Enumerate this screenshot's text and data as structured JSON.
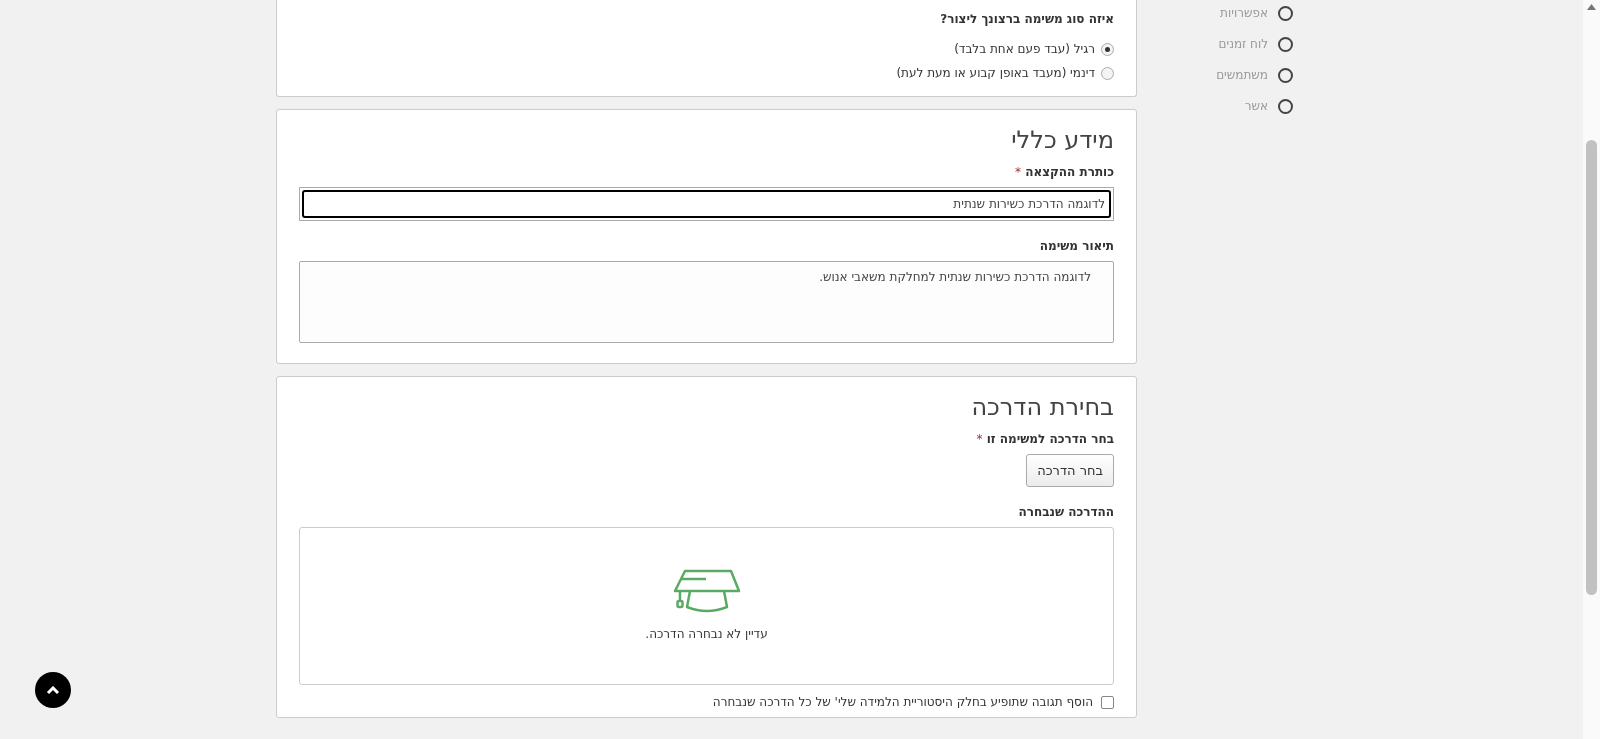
{
  "task_type": {
    "question": "איזה סוג משימה ברצונך ליצור?",
    "options": [
      {
        "label": "רגיל (עבד פעם אחת בלבד)",
        "selected": true
      },
      {
        "label": "דינמי (מעבד באופן קבוע או מעת לעת)",
        "selected": false
      }
    ]
  },
  "general_info": {
    "title": "מידע כללי",
    "assignment_title": {
      "label": "כותרת ההקצאה",
      "required_mark": "*",
      "value": "לדוגמה הדרכת כשירות שנתית"
    },
    "description": {
      "label": "תיאור משימה",
      "value": "לדוגמה הדרכת כשירות שנתית למחלקת משאבי אנוש."
    }
  },
  "training_selection": {
    "title": "בחירת הדרכה",
    "choose_label": "בחר הדרכה למשימה זו",
    "required_mark": "*",
    "choose_button": "בחר הדרכה",
    "selected_label": "ההדרכה שנבחרה",
    "empty_message": "עדיין לא נבחרה הדרכה.",
    "comment_option": {
      "label": "הוסף תגובה שתופיע בחלק היסטוריית הלמידה שלי' של כל הדרכה שנבחרה",
      "checked": false
    }
  },
  "steps": [
    {
      "label": "אפשרויות"
    },
    {
      "label": "לוח זמנים"
    },
    {
      "label": "משתמשים"
    },
    {
      "label": "אשר"
    }
  ]
}
